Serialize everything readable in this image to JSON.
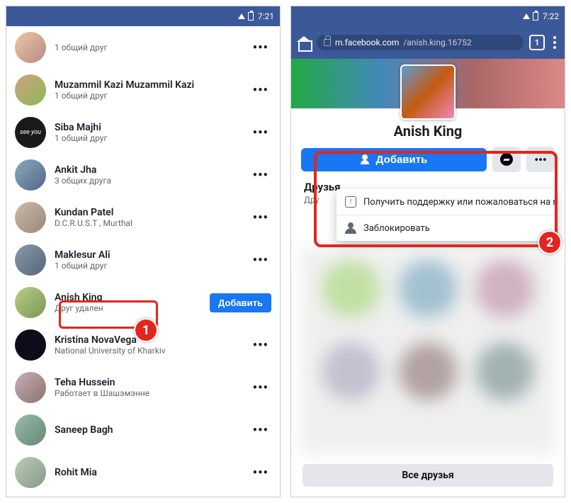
{
  "left": {
    "time": "7:21",
    "friends": [
      {
        "name": "",
        "sub": "1 общий друг"
      },
      {
        "name": "Muzammil Kazi Muzammil Kazi",
        "sub": "1 общий друг"
      },
      {
        "name": "Siba Majhi",
        "sub": "1 общий друг"
      },
      {
        "name": "Ankit Jha",
        "sub": "3 общих друга"
      },
      {
        "name": "Kundan Patel",
        "sub": "D.C.R.U.S.T , Murthal"
      },
      {
        "name": "Maklesur Ali",
        "sub": "1 общий друг"
      },
      {
        "name": "Anish King",
        "sub": "Друг удален"
      },
      {
        "name": "Kristina NovaVega",
        "sub": "National University of Kharkiv"
      },
      {
        "name": "Teha Hussein",
        "sub": "Работает в Шашэмэнне"
      },
      {
        "name": "Saneep Bagh",
        "sub": ""
      },
      {
        "name": "Rohit Mia",
        "sub": ""
      }
    ],
    "add_button": "Добавить",
    "callout": "1",
    "see_you": "see you"
  },
  "right": {
    "time": "7:22",
    "url_domain": "m.facebook.com",
    "url_path": "/anish.king.16752",
    "tab_count": "1",
    "profile_name": "Anish King",
    "add_button": "Добавить",
    "more": "•••",
    "friends_label": "Друзья",
    "friends_sub": "Дру",
    "menu": {
      "report": "Получить поддержку или пожаловаться на профи...",
      "block": "Заблокировать"
    },
    "all_friends": "Все друзья",
    "callout": "2",
    "info_char": "!"
  }
}
